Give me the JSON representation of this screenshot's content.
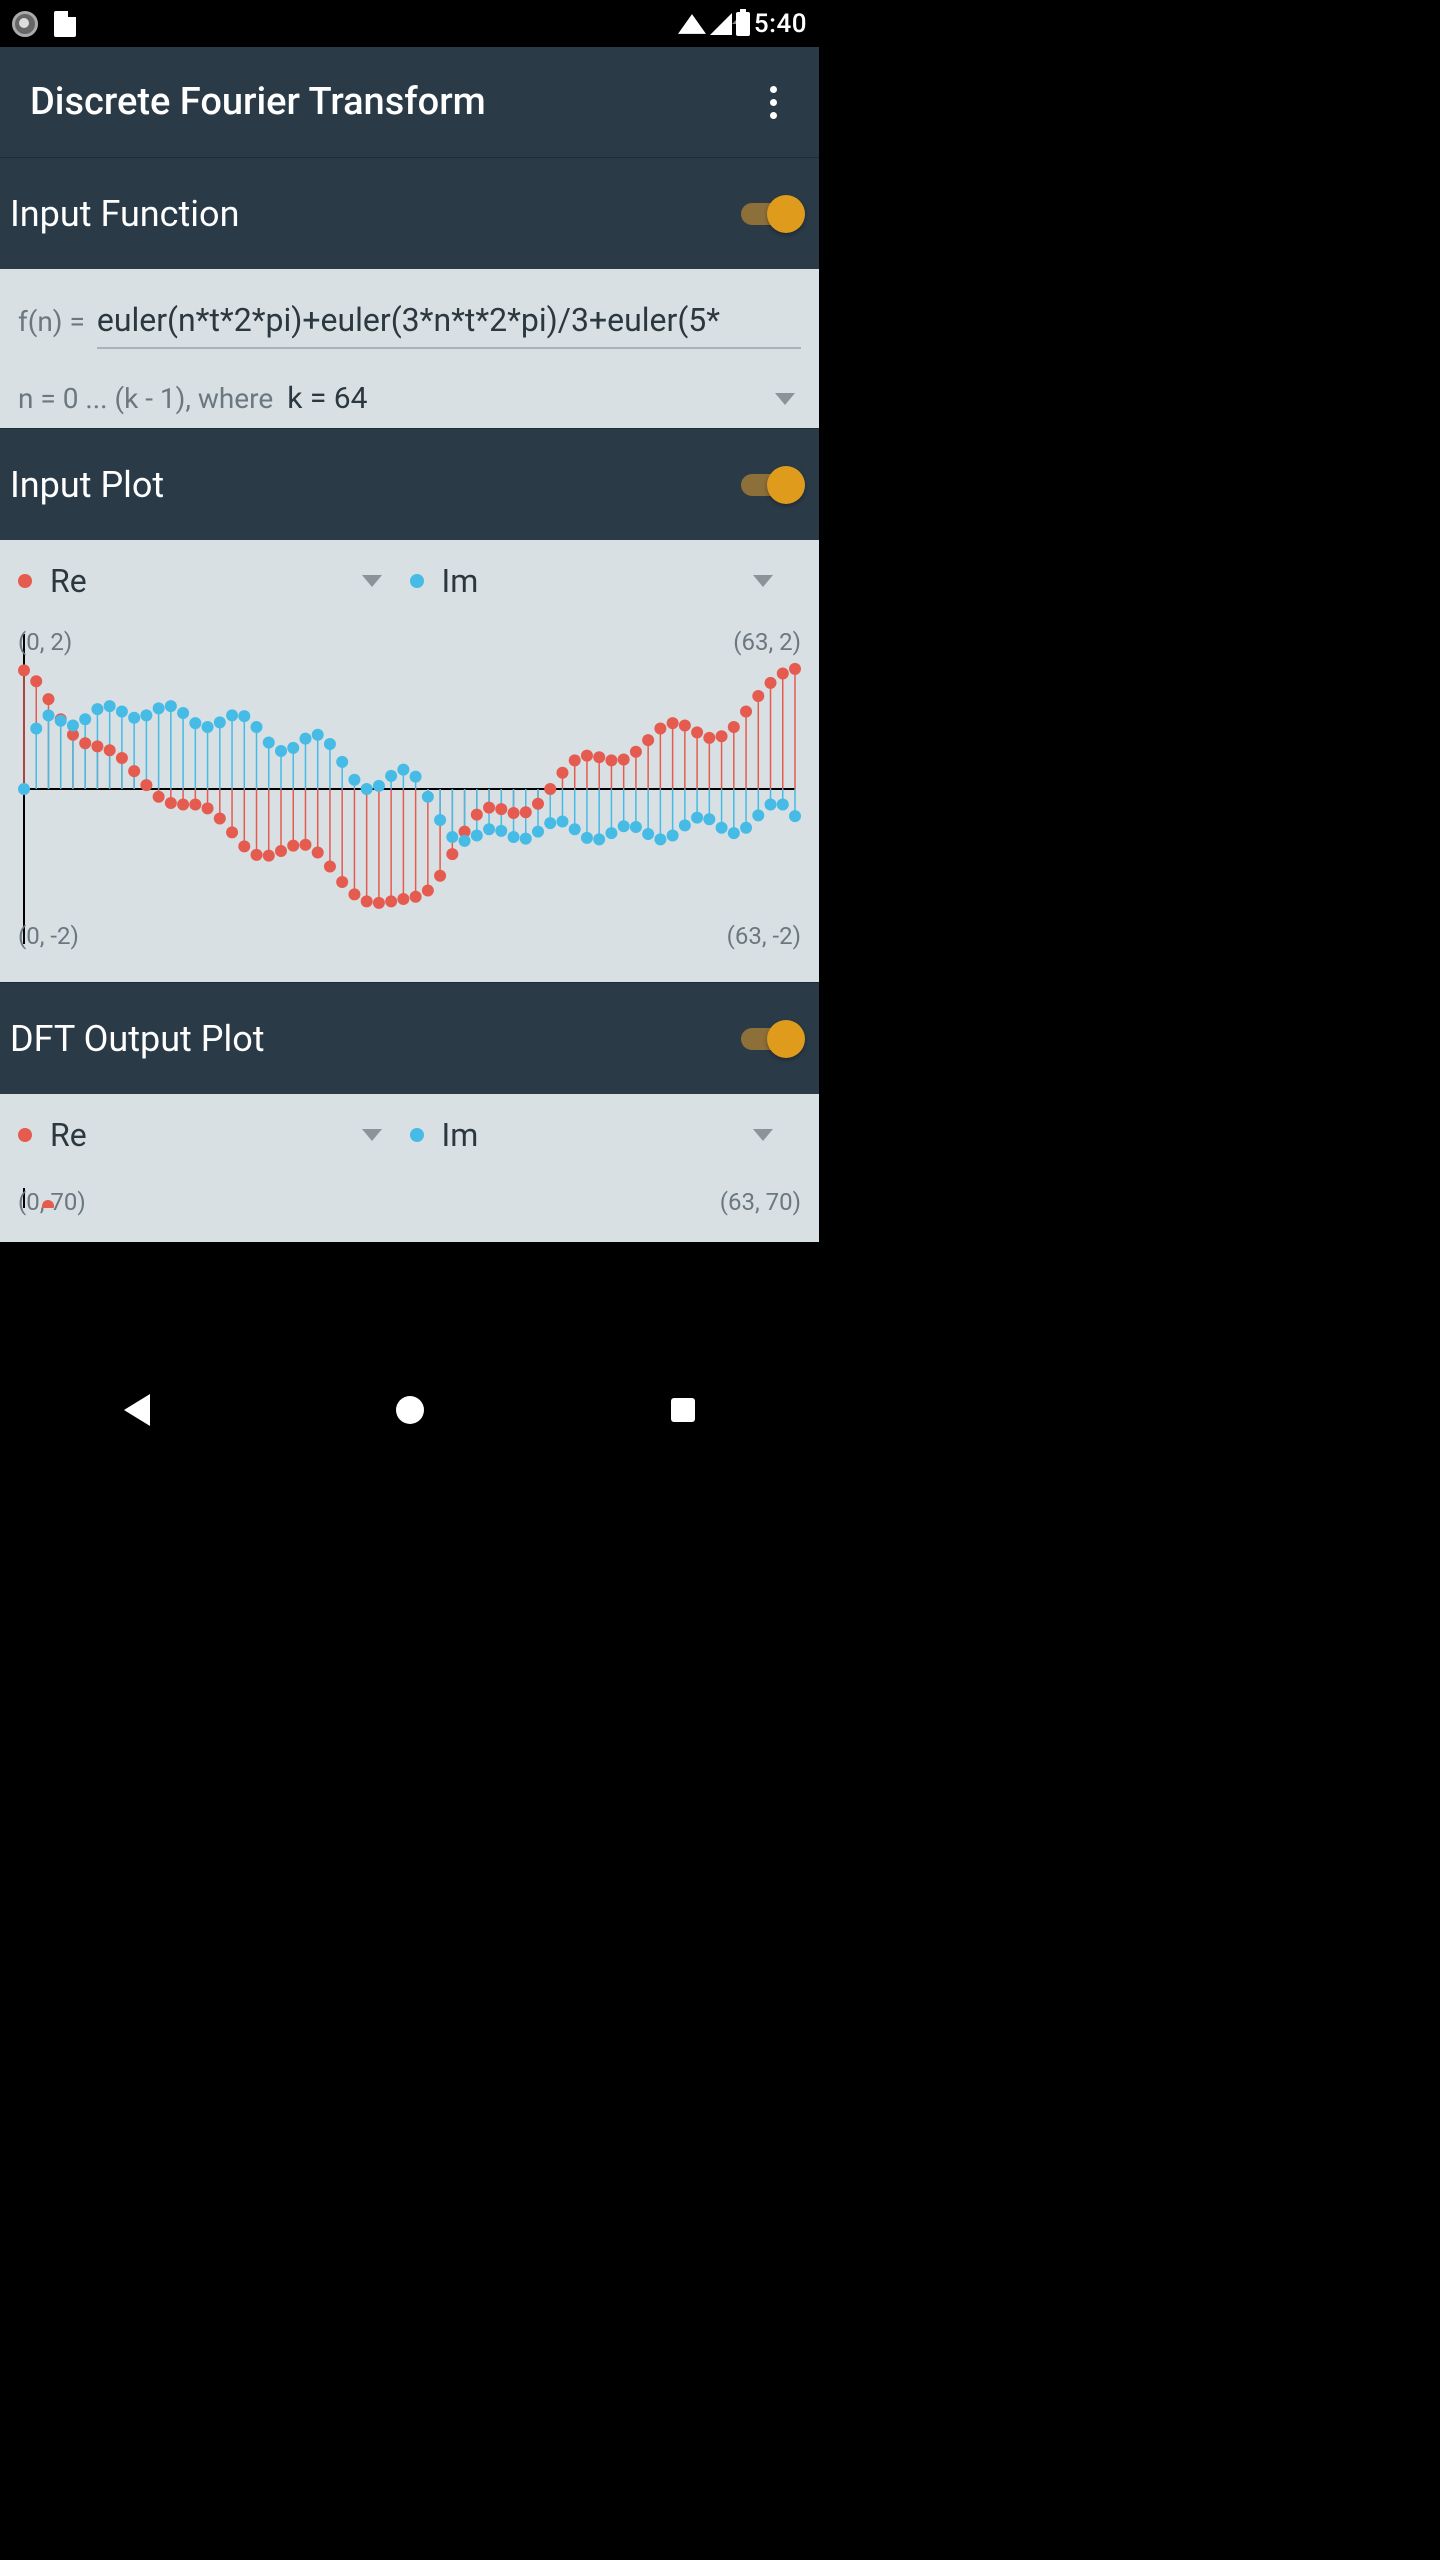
{
  "status": {
    "time": "5:40"
  },
  "appbar": {
    "title": "Discrete Fourier Transform"
  },
  "sections": {
    "inputFunction": {
      "title": "Input Function",
      "toggle": true,
      "fn_prefix": "f(n) =",
      "fn_value": "euler(n*t*2*pi)+euler(3*n*t*2*pi)/3+euler(5*",
      "range_prefix": "n = 0 ... (k - 1), where",
      "range_value": "k = 64"
    },
    "inputPlot": {
      "title": "Input Plot",
      "toggle": true,
      "legend": {
        "re": "Re",
        "im": "Im"
      },
      "corners": {
        "tl": "(0, 2)",
        "tr": "(63, 2)",
        "bl": "(0, -2)",
        "br": "(63, -2)"
      }
    },
    "dftPlot": {
      "title": "DFT Output Plot",
      "toggle": true,
      "legend": {
        "re": "Re",
        "im": "Im"
      },
      "corners": {
        "tl": "(0, 70)",
        "tr": "(63, 70)"
      }
    }
  },
  "chart_data": [
    {
      "id": "input_plot",
      "type": "stem",
      "x": [
        0,
        1,
        2,
        3,
        4,
        5,
        6,
        7,
        8,
        9,
        10,
        11,
        12,
        13,
        14,
        15,
        16,
        17,
        18,
        19,
        20,
        21,
        22,
        23,
        24,
        25,
        26,
        27,
        28,
        29,
        30,
        31,
        32,
        33,
        34,
        35,
        36,
        37,
        38,
        39,
        40,
        41,
        42,
        43,
        44,
        45,
        46,
        47,
        48,
        49,
        50,
        51,
        52,
        53,
        54,
        55,
        56,
        57,
        58,
        59,
        60,
        61,
        62,
        63
      ],
      "xlim": [
        0,
        63
      ],
      "ylim": [
        -2,
        2
      ],
      "series": [
        {
          "name": "Re",
          "color": "#e55b4f",
          "values": [
            1.53,
            1.39,
            1.16,
            0.9,
            0.7,
            0.59,
            0.55,
            0.5,
            0.4,
            0.23,
            0.05,
            -0.1,
            -0.18,
            -0.2,
            -0.2,
            -0.25,
            -0.38,
            -0.56,
            -0.74,
            -0.85,
            -0.86,
            -0.8,
            -0.73,
            -0.72,
            -0.82,
            -1.0,
            -1.2,
            -1.36,
            -1.45,
            -1.47,
            -1.45,
            -1.42,
            -1.39,
            -1.31,
            -1.12,
            -0.84,
            -0.55,
            -0.33,
            -0.24,
            -0.26,
            -0.31,
            -0.3,
            -0.19,
            0.0,
            0.21,
            0.37,
            0.43,
            0.41,
            0.37,
            0.38,
            0.48,
            0.63,
            0.78,
            0.85,
            0.82,
            0.73,
            0.66,
            0.68,
            0.8,
            1.0,
            1.2,
            1.37,
            1.49,
            1.55
          ]
        },
        {
          "name": "Im",
          "color": "#46bbe5",
          "values": [
            0.0,
            0.78,
            0.95,
            0.88,
            0.82,
            0.9,
            1.03,
            1.07,
            1.0,
            0.92,
            0.95,
            1.04,
            1.07,
            0.98,
            0.85,
            0.8,
            0.86,
            0.95,
            0.94,
            0.8,
            0.6,
            0.49,
            0.53,
            0.65,
            0.7,
            0.58,
            0.35,
            0.12,
            0.0,
            0.04,
            0.17,
            0.25,
            0.16,
            -0.1,
            -0.4,
            -0.62,
            -0.67,
            -0.6,
            -0.52,
            -0.54,
            -0.62,
            -0.64,
            -0.55,
            -0.44,
            -0.42,
            -0.52,
            -0.63,
            -0.65,
            -0.57,
            -0.48,
            -0.49,
            -0.58,
            -0.65,
            -0.6,
            -0.47,
            -0.37,
            -0.39,
            -0.5,
            -0.57,
            -0.5,
            -0.34,
            -0.2,
            -0.2,
            -0.35
          ]
        }
      ]
    },
    {
      "id": "dft_output_plot",
      "type": "stem",
      "xlim": [
        0,
        63
      ],
      "ylim": [
        -70,
        70
      ],
      "series_visible": [
        "Re",
        "Im"
      ],
      "note": "plot area cropped in screenshot; only top corners and legend visible"
    }
  ]
}
